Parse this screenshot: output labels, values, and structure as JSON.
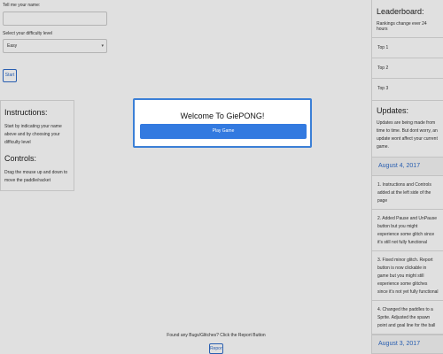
{
  "form": {
    "name_label": "Tell me your name:",
    "name_value": "",
    "difficulty_label": "Select your difficulty level",
    "difficulty_selected": "Easy",
    "start_label": "Start"
  },
  "instructions": {
    "title": "Instructions:",
    "text": "Start by indicating your name above and by choosing your difficulty level",
    "controls_title": "Controls:",
    "controls_text": "Drag the mouse up and down to move the paddle/racket"
  },
  "leaderboard": {
    "title": "Leaderboard:",
    "note": "Rankings change ever 24 hours",
    "rows": [
      "Top 1",
      "Top 2",
      "Top 3"
    ]
  },
  "updates": {
    "title": "Updates:",
    "note": "Updates are being made from time to time. But dont worry, an update wont affect your current game.",
    "date1": "August 4, 2017",
    "items": [
      "1. Instructions and Controls added at the left side of the page",
      "2. Added Pause and UnPause button but you might experience some glitch since it's still not fully functional",
      "3. Fixed minor glitch. Report button is now clickable in game but you might still experience some glitches since it's not yet fully functional",
      "4. Changed the paddles to a Sprite. Adjusted the spawn point and goal line for the ball"
    ],
    "date2": "August 3, 2017"
  },
  "footer": {
    "text": "Found any Bugs/Glitches? Click the Report Button",
    "report_label": "Report"
  },
  "modal": {
    "title": "Welcome To GiePONG!",
    "play_label": "Play Game"
  },
  "colors": {
    "accent": "#337ae0",
    "modal_border": "#3b7fd6",
    "date_text": "#2f6cc9"
  }
}
